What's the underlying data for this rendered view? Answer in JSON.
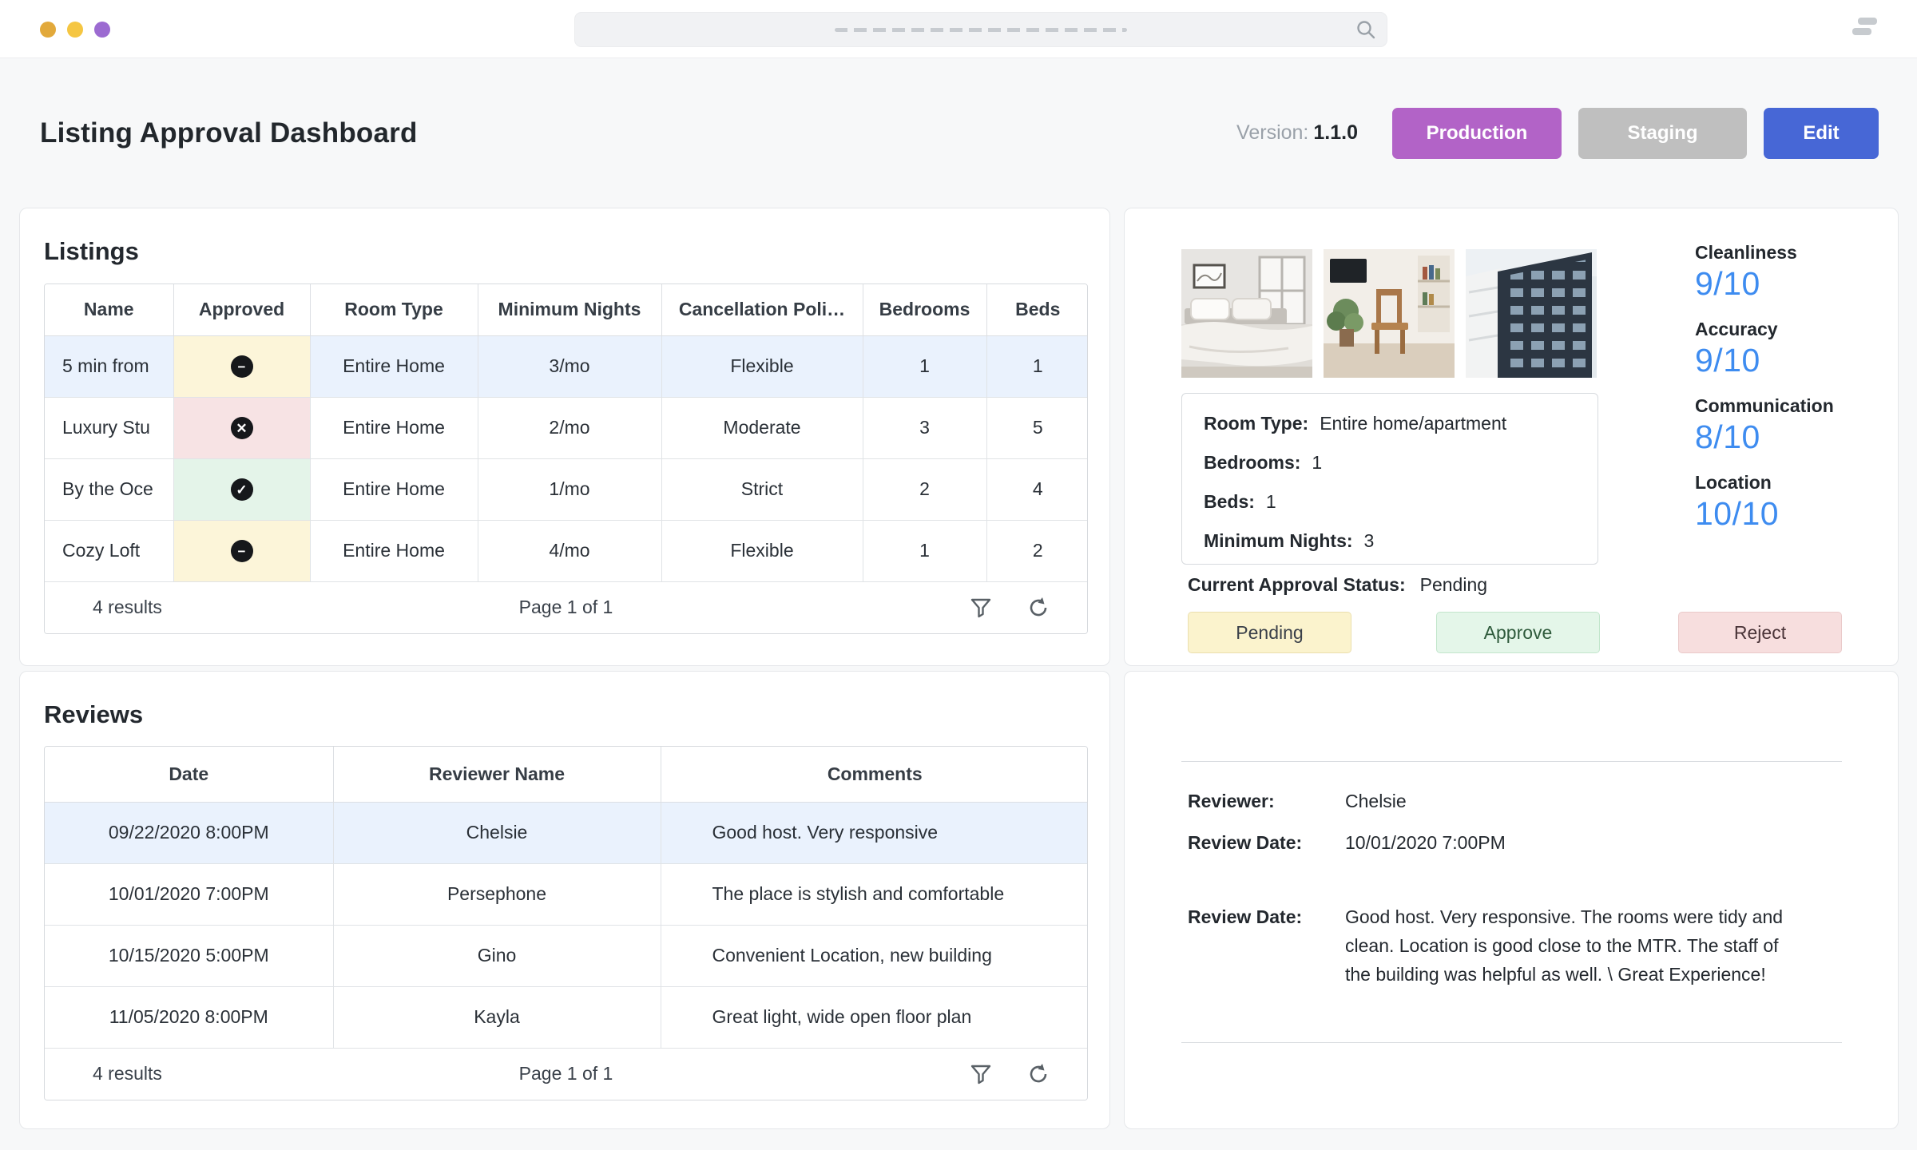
{
  "chrome": {
    "dot_colors": [
      "#E2A93B",
      "#F5C642",
      "#9C6BD1"
    ],
    "icons": {
      "search": "magnifier",
      "stack": "window-stack"
    }
  },
  "header": {
    "title": "Listing Approval Dashboard",
    "version_label": "Version:",
    "version_value": "1.1.0",
    "production_label": "Production",
    "staging_label": "Staging",
    "edit_label": "Edit",
    "production_color": "#B263C7",
    "staging_color": "#BFBFBF",
    "edit_color": "#4767D6"
  },
  "listings": {
    "title": "Listings",
    "columns": [
      "Name",
      "Approved",
      "Room Type",
      "Minimum Nights",
      "Cancellation Poli…",
      "Bedrooms",
      "Beds"
    ],
    "rows": [
      {
        "name": "5 min from",
        "approved": "pending",
        "room_type": "Entire Home",
        "minimum_nights": "3/mo",
        "cancellation": "Flexible",
        "bedrooms": "1",
        "beds": "1",
        "selected": true
      },
      {
        "name": "Luxury Stu",
        "approved": "rejected",
        "room_type": "Entire Home",
        "minimum_nights": "2/mo",
        "cancellation": "Moderate",
        "bedrooms": "3",
        "beds": "5",
        "selected": false
      },
      {
        "name": "By the Oce",
        "approved": "approved",
        "room_type": "Entire Home",
        "minimum_nights": "1/mo",
        "cancellation": "Strict",
        "bedrooms": "2",
        "beds": "4",
        "selected": false
      },
      {
        "name": "Cozy Loft",
        "approved": "pending",
        "room_type": "Entire Home",
        "minimum_nights": "4/mo",
        "cancellation": "Flexible",
        "bedrooms": "1",
        "beds": "2",
        "selected": false
      }
    ],
    "results_text": "4 results",
    "page_text": "Page 1 of 1"
  },
  "reviews": {
    "title": "Reviews",
    "columns": [
      "Date",
      "Reviewer Name",
      "Comments"
    ],
    "rows": [
      {
        "date": "09/22/2020 8:00PM",
        "reviewer": "Chelsie",
        "comments": "Good host. Very responsive",
        "selected": true
      },
      {
        "date": "10/01/2020 7:00PM",
        "reviewer": "Persephone",
        "comments": "The place is stylish and comfortable",
        "selected": false
      },
      {
        "date": "10/15/2020 5:00PM",
        "reviewer": "Gino",
        "comments": "Convenient Location, new building",
        "selected": false
      },
      {
        "date": "11/05/2020 8:00PM",
        "reviewer": "Kayla",
        "comments": "Great light, wide open floor plan",
        "selected": false
      }
    ],
    "results_text": "4 results",
    "page_text": "Page 1 of 1"
  },
  "listing_detail": {
    "photos": [
      "bedroom-photo",
      "living-room-photo",
      "building-photo"
    ],
    "ratings": [
      {
        "label": "Cleanliness",
        "value": "9/10"
      },
      {
        "label": "Accuracy",
        "value": "9/10"
      },
      {
        "label": "Communication",
        "value": "8/10"
      },
      {
        "label": "Location",
        "value": "10/10"
      }
    ],
    "rating_color": "#3E8CF0",
    "info": [
      {
        "label": "Room Type:",
        "value": "Entire home/apartment"
      },
      {
        "label": "Bedrooms:",
        "value": "1"
      },
      {
        "label": "Beds:",
        "value": "1"
      },
      {
        "label": "Minimum Nights:",
        "value": "3"
      }
    ],
    "status_label": "Current Approval Status:",
    "status_value": "Pending",
    "pending_label": "Pending",
    "approve_label": "Approve",
    "reject_label": "Reject",
    "status_icons": {
      "pending": "circle-minus",
      "rejected": "circle-x",
      "approved": "circle-check"
    }
  },
  "review_detail": {
    "reviewer_label": "Reviewer:",
    "reviewer_value": "Chelsie",
    "date_label": "Review Date:",
    "date_value": "10/01/2020 7:00PM",
    "comment_label": "Review Date:",
    "comment_value": "Good host. Very responsive. The rooms were tidy and clean. Location is good close to the MTR. The staff of the building was helpful as well. \\ Great Experience!"
  },
  "status_colors": {
    "pending_bg": "#FCF5D9",
    "rejected_bg": "#F7E3E4",
    "approved_bg": "#E4F4E9",
    "selected_row_bg": "#EAF2FD"
  }
}
